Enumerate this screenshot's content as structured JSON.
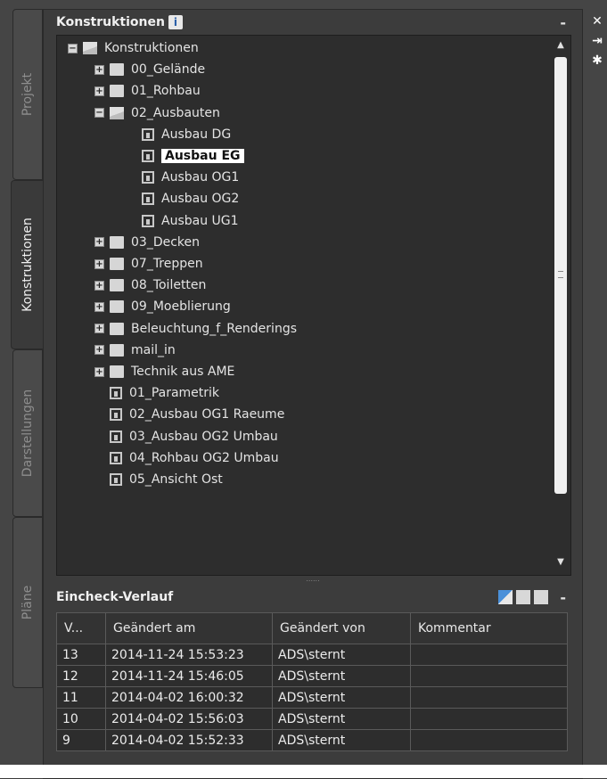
{
  "side_tabs": [
    {
      "label": "Projekt",
      "active": false
    },
    {
      "label": "Konstruktionen",
      "active": true
    },
    {
      "label": "Darstellungen",
      "active": false
    },
    {
      "label": "Pläne",
      "active": false
    }
  ],
  "constructions": {
    "title": "Konstruktionen",
    "info_icon": "i",
    "minimize": "-"
  },
  "tree": [
    {
      "label": "Konstruktionen",
      "level": 0,
      "icon": "folder-open",
      "toggle": "−"
    },
    {
      "label": "00_Gelände",
      "level": 1,
      "icon": "folder",
      "toggle": "+"
    },
    {
      "label": "01_Rohbau",
      "level": 1,
      "icon": "folder",
      "toggle": "+"
    },
    {
      "label": "02_Ausbauten",
      "level": 1,
      "icon": "folder-open",
      "toggle": "−"
    },
    {
      "label": "Ausbau DG",
      "level": 2,
      "icon": "dwg",
      "toggle": ""
    },
    {
      "label": "Ausbau EG",
      "level": 2,
      "icon": "dwg",
      "toggle": "",
      "selected": true
    },
    {
      "label": "Ausbau OG1",
      "level": 2,
      "icon": "dwg",
      "toggle": ""
    },
    {
      "label": "Ausbau OG2",
      "level": 2,
      "icon": "dwg",
      "toggle": ""
    },
    {
      "label": "Ausbau UG1",
      "level": 2,
      "icon": "dwg",
      "toggle": ""
    },
    {
      "label": "03_Decken",
      "level": 1,
      "icon": "folder",
      "toggle": "+"
    },
    {
      "label": "07_Treppen",
      "level": 1,
      "icon": "folder",
      "toggle": "+"
    },
    {
      "label": "08_Toiletten",
      "level": 1,
      "icon": "folder",
      "toggle": "+"
    },
    {
      "label": "09_Moeblierung",
      "level": 1,
      "icon": "folder",
      "toggle": "+"
    },
    {
      "label": "Beleuchtung_f_Renderings",
      "level": 1,
      "icon": "folder",
      "toggle": "+"
    },
    {
      "label": "mail_in",
      "level": 1,
      "icon": "folder",
      "toggle": "+"
    },
    {
      "label": "Technik aus AME",
      "level": 1,
      "icon": "folder",
      "toggle": "+"
    },
    {
      "label": "01_Parametrik",
      "level": 1,
      "icon": "dwg",
      "toggle": ""
    },
    {
      "label": "02_Ausbau OG1 Raeume",
      "level": 1,
      "icon": "dwg",
      "toggle": ""
    },
    {
      "label": "03_Ausbau OG2 Umbau",
      "level": 1,
      "icon": "dwg",
      "toggle": ""
    },
    {
      "label": "04_Rohbau OG2 Umbau",
      "level": 1,
      "icon": "dwg",
      "toggle": ""
    },
    {
      "label": "05_Ansicht Ost",
      "level": 1,
      "icon": "dwg",
      "toggle": ""
    }
  ],
  "splitter_grip": "......",
  "history": {
    "title": "Eincheck-Verlauf",
    "minimize": "-",
    "columns": [
      "V...",
      "Geändert am",
      "Geändert von",
      "Kommentar"
    ],
    "rows": [
      {
        "v": "13",
        "date": "2014-11-24 15:53:23",
        "by": "ADS\\sternt",
        "comment": ""
      },
      {
        "v": "12",
        "date": "2014-11-24 15:46:05",
        "by": "ADS\\sternt",
        "comment": ""
      },
      {
        "v": "11",
        "date": "2014-04-02 16:00:32",
        "by": "ADS\\sternt",
        "comment": ""
      },
      {
        "v": "10",
        "date": "2014-04-02 15:56:03",
        "by": "ADS\\sternt",
        "comment": ""
      },
      {
        "v": "9",
        "date": "2014-04-02 15:52:33",
        "by": "ADS\\sternt",
        "comment": ""
      }
    ]
  },
  "scroll": {
    "up": "▲",
    "down": "▼"
  },
  "window_tools": [
    "✕",
    "⇥",
    "✱"
  ]
}
